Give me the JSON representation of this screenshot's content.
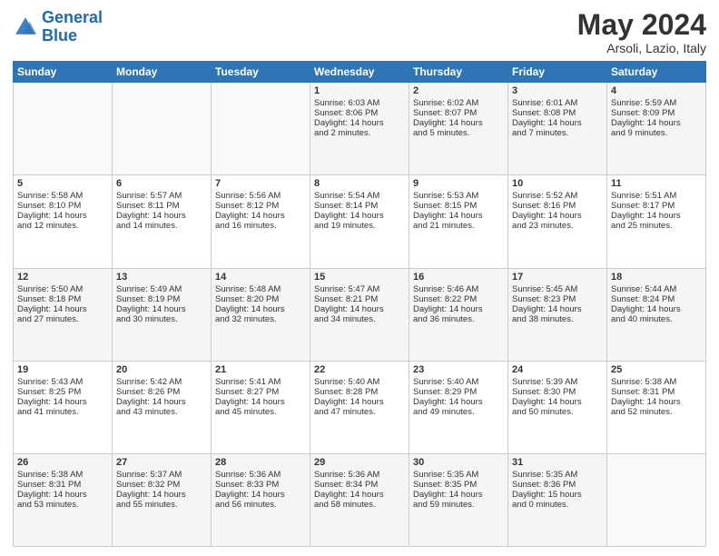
{
  "logo": {
    "text_general": "General",
    "text_blue": "Blue"
  },
  "header": {
    "title": "May 2024",
    "subtitle": "Arsoli, Lazio, Italy"
  },
  "columns": [
    "Sunday",
    "Monday",
    "Tuesday",
    "Wednesday",
    "Thursday",
    "Friday",
    "Saturday"
  ],
  "weeks": [
    {
      "days": [
        {
          "num": "",
          "lines": []
        },
        {
          "num": "",
          "lines": []
        },
        {
          "num": "",
          "lines": []
        },
        {
          "num": "1",
          "lines": [
            "Sunrise: 6:03 AM",
            "Sunset: 8:06 PM",
            "Daylight: 14 hours",
            "and 2 minutes."
          ]
        },
        {
          "num": "2",
          "lines": [
            "Sunrise: 6:02 AM",
            "Sunset: 8:07 PM",
            "Daylight: 14 hours",
            "and 5 minutes."
          ]
        },
        {
          "num": "3",
          "lines": [
            "Sunrise: 6:01 AM",
            "Sunset: 8:08 PM",
            "Daylight: 14 hours",
            "and 7 minutes."
          ]
        },
        {
          "num": "4",
          "lines": [
            "Sunrise: 5:59 AM",
            "Sunset: 8:09 PM",
            "Daylight: 14 hours",
            "and 9 minutes."
          ]
        }
      ]
    },
    {
      "days": [
        {
          "num": "5",
          "lines": [
            "Sunrise: 5:58 AM",
            "Sunset: 8:10 PM",
            "Daylight: 14 hours",
            "and 12 minutes."
          ]
        },
        {
          "num": "6",
          "lines": [
            "Sunrise: 5:57 AM",
            "Sunset: 8:11 PM",
            "Daylight: 14 hours",
            "and 14 minutes."
          ]
        },
        {
          "num": "7",
          "lines": [
            "Sunrise: 5:56 AM",
            "Sunset: 8:12 PM",
            "Daylight: 14 hours",
            "and 16 minutes."
          ]
        },
        {
          "num": "8",
          "lines": [
            "Sunrise: 5:54 AM",
            "Sunset: 8:14 PM",
            "Daylight: 14 hours",
            "and 19 minutes."
          ]
        },
        {
          "num": "9",
          "lines": [
            "Sunrise: 5:53 AM",
            "Sunset: 8:15 PM",
            "Daylight: 14 hours",
            "and 21 minutes."
          ]
        },
        {
          "num": "10",
          "lines": [
            "Sunrise: 5:52 AM",
            "Sunset: 8:16 PM",
            "Daylight: 14 hours",
            "and 23 minutes."
          ]
        },
        {
          "num": "11",
          "lines": [
            "Sunrise: 5:51 AM",
            "Sunset: 8:17 PM",
            "Daylight: 14 hours",
            "and 25 minutes."
          ]
        }
      ]
    },
    {
      "days": [
        {
          "num": "12",
          "lines": [
            "Sunrise: 5:50 AM",
            "Sunset: 8:18 PM",
            "Daylight: 14 hours",
            "and 27 minutes."
          ]
        },
        {
          "num": "13",
          "lines": [
            "Sunrise: 5:49 AM",
            "Sunset: 8:19 PM",
            "Daylight: 14 hours",
            "and 30 minutes."
          ]
        },
        {
          "num": "14",
          "lines": [
            "Sunrise: 5:48 AM",
            "Sunset: 8:20 PM",
            "Daylight: 14 hours",
            "and 32 minutes."
          ]
        },
        {
          "num": "15",
          "lines": [
            "Sunrise: 5:47 AM",
            "Sunset: 8:21 PM",
            "Daylight: 14 hours",
            "and 34 minutes."
          ]
        },
        {
          "num": "16",
          "lines": [
            "Sunrise: 5:46 AM",
            "Sunset: 8:22 PM",
            "Daylight: 14 hours",
            "and 36 minutes."
          ]
        },
        {
          "num": "17",
          "lines": [
            "Sunrise: 5:45 AM",
            "Sunset: 8:23 PM",
            "Daylight: 14 hours",
            "and 38 minutes."
          ]
        },
        {
          "num": "18",
          "lines": [
            "Sunrise: 5:44 AM",
            "Sunset: 8:24 PM",
            "Daylight: 14 hours",
            "and 40 minutes."
          ]
        }
      ]
    },
    {
      "days": [
        {
          "num": "19",
          "lines": [
            "Sunrise: 5:43 AM",
            "Sunset: 8:25 PM",
            "Daylight: 14 hours",
            "and 41 minutes."
          ]
        },
        {
          "num": "20",
          "lines": [
            "Sunrise: 5:42 AM",
            "Sunset: 8:26 PM",
            "Daylight: 14 hours",
            "and 43 minutes."
          ]
        },
        {
          "num": "21",
          "lines": [
            "Sunrise: 5:41 AM",
            "Sunset: 8:27 PM",
            "Daylight: 14 hours",
            "and 45 minutes."
          ]
        },
        {
          "num": "22",
          "lines": [
            "Sunrise: 5:40 AM",
            "Sunset: 8:28 PM",
            "Daylight: 14 hours",
            "and 47 minutes."
          ]
        },
        {
          "num": "23",
          "lines": [
            "Sunrise: 5:40 AM",
            "Sunset: 8:29 PM",
            "Daylight: 14 hours",
            "and 49 minutes."
          ]
        },
        {
          "num": "24",
          "lines": [
            "Sunrise: 5:39 AM",
            "Sunset: 8:30 PM",
            "Daylight: 14 hours",
            "and 50 minutes."
          ]
        },
        {
          "num": "25",
          "lines": [
            "Sunrise: 5:38 AM",
            "Sunset: 8:31 PM",
            "Daylight: 14 hours",
            "and 52 minutes."
          ]
        }
      ]
    },
    {
      "days": [
        {
          "num": "26",
          "lines": [
            "Sunrise: 5:38 AM",
            "Sunset: 8:31 PM",
            "Daylight: 14 hours",
            "and 53 minutes."
          ]
        },
        {
          "num": "27",
          "lines": [
            "Sunrise: 5:37 AM",
            "Sunset: 8:32 PM",
            "Daylight: 14 hours",
            "and 55 minutes."
          ]
        },
        {
          "num": "28",
          "lines": [
            "Sunrise: 5:36 AM",
            "Sunset: 8:33 PM",
            "Daylight: 14 hours",
            "and 56 minutes."
          ]
        },
        {
          "num": "29",
          "lines": [
            "Sunrise: 5:36 AM",
            "Sunset: 8:34 PM",
            "Daylight: 14 hours",
            "and 58 minutes."
          ]
        },
        {
          "num": "30",
          "lines": [
            "Sunrise: 5:35 AM",
            "Sunset: 8:35 PM",
            "Daylight: 14 hours",
            "and 59 minutes."
          ]
        },
        {
          "num": "31",
          "lines": [
            "Sunrise: 5:35 AM",
            "Sunset: 8:36 PM",
            "Daylight: 15 hours",
            "and 0 minutes."
          ]
        },
        {
          "num": "",
          "lines": []
        }
      ]
    }
  ]
}
